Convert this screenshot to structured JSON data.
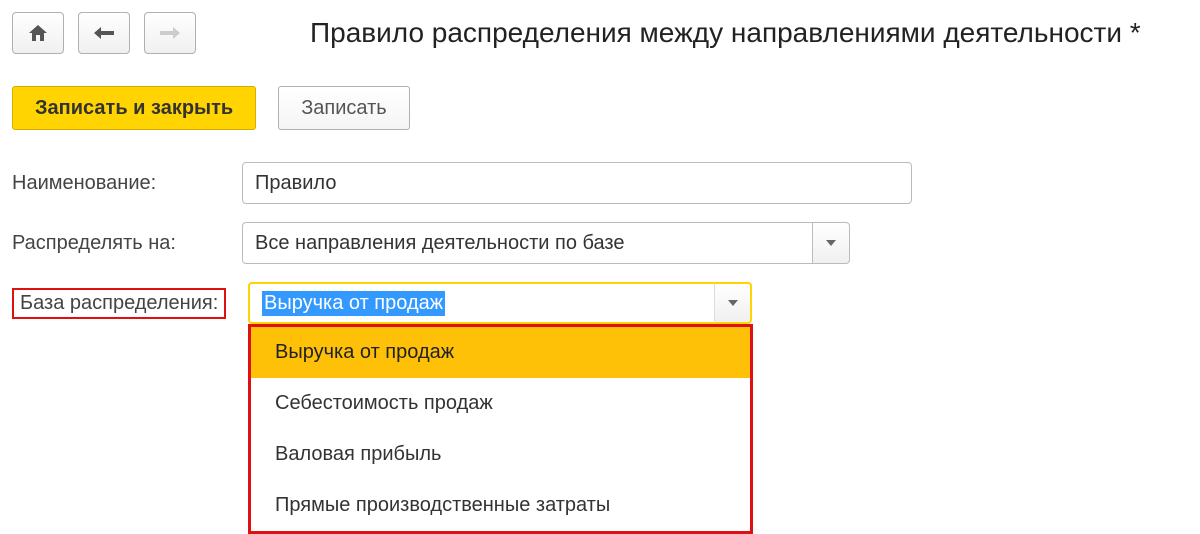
{
  "header": {
    "title": "Правило распределения между направлениями деятельности *"
  },
  "toolbar": {
    "save_close": "Записать и закрыть",
    "save": "Записать"
  },
  "form": {
    "name_label": "Наименование:",
    "name_value": "Правило",
    "distribute_label": "Распределять на:",
    "distribute_value": "Все направления деятельности по базе",
    "base_label": "База распределения:",
    "base_value": "Выручка от продаж",
    "base_options": [
      "Выручка от продаж",
      "Себестоимость продаж",
      "Валовая прибыль",
      "Прямые производственные затраты"
    ]
  }
}
